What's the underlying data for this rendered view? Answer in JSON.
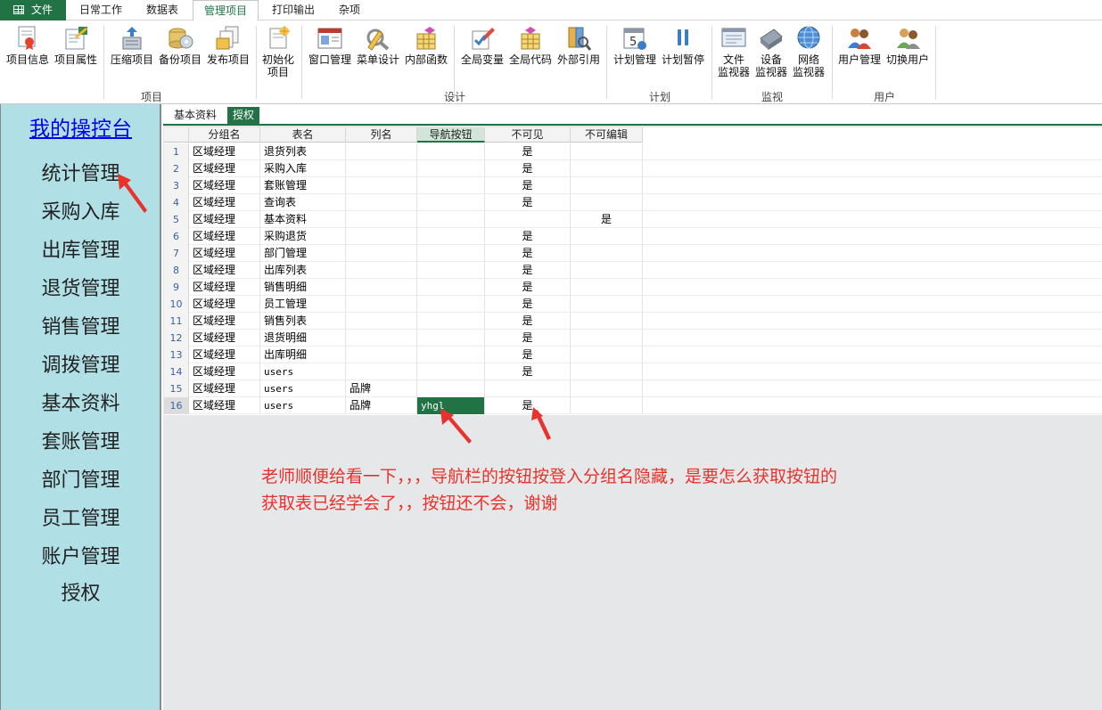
{
  "ribbon_tabs": [
    "文件",
    "日常工作",
    "数据表",
    "管理项目",
    "打印输出",
    "杂项"
  ],
  "ribbon_groups": [
    "项目",
    "设计",
    "计划",
    "监视",
    "用户"
  ],
  "ribbon_buttons": [
    {
      "label": "项目信息",
      "icon": "certificate-icon"
    },
    {
      "label": "项目属性",
      "icon": "document-pencil-icon"
    },
    {
      "label": "压缩项目",
      "icon": "compress-icon"
    },
    {
      "label": "备份项目",
      "icon": "backup-disc-icon"
    },
    {
      "label": "发布项目",
      "icon": "publish-icon"
    },
    {
      "label": "初始化\n项目",
      "icon": "init-project-icon"
    },
    {
      "label": "窗口管理",
      "icon": "window-icon"
    },
    {
      "label": "菜单设计",
      "icon": "menu-design-icon"
    },
    {
      "label": "内部函数",
      "icon": "function-icon"
    },
    {
      "label": "全局变量",
      "icon": "variable-icon"
    },
    {
      "label": "全局代码",
      "icon": "code-icon"
    },
    {
      "label": "外部引用",
      "icon": "reference-icon"
    },
    {
      "label": "计划管理",
      "icon": "calendar-icon"
    },
    {
      "label": "计划暂停",
      "icon": "pause-icon"
    },
    {
      "label": "文件\n监视器",
      "icon": "file-monitor-icon"
    },
    {
      "label": "设备\n监视器",
      "icon": "device-monitor-icon"
    },
    {
      "label": "网络\n监视器",
      "icon": "globe-icon"
    },
    {
      "label": "用户管理",
      "icon": "users-icon"
    },
    {
      "label": "切换用户",
      "icon": "switch-user-icon"
    }
  ],
  "sidebar": {
    "title": "我的操控台",
    "items": [
      "统计管理",
      "采购入库",
      "出库管理",
      "退货管理",
      "销售管理",
      "调拨管理",
      "基本资料",
      "套账管理",
      "部门管理",
      "员工管理",
      "账户管理",
      "授权"
    ]
  },
  "subtabs": [
    "基本资料",
    "授权"
  ],
  "grid": {
    "columns": [
      "分组名",
      "表名",
      "列名",
      "导航按钮",
      "不可见",
      "不可编辑"
    ],
    "rows": [
      {
        "n": "1",
        "group": "区域经理",
        "table": "退货列表",
        "col": "",
        "nav": "",
        "hidden": "是",
        "noedit": ""
      },
      {
        "n": "2",
        "group": "区域经理",
        "table": "采购入库",
        "col": "",
        "nav": "",
        "hidden": "是",
        "noedit": ""
      },
      {
        "n": "3",
        "group": "区域经理",
        "table": "套账管理",
        "col": "",
        "nav": "",
        "hidden": "是",
        "noedit": ""
      },
      {
        "n": "4",
        "group": "区域经理",
        "table": "查询表",
        "col": "",
        "nav": "",
        "hidden": "是",
        "noedit": ""
      },
      {
        "n": "5",
        "group": "区域经理",
        "table": "基本资料",
        "col": "",
        "nav": "",
        "hidden": "",
        "noedit": "是"
      },
      {
        "n": "6",
        "group": "区域经理",
        "table": "采购退货",
        "col": "",
        "nav": "",
        "hidden": "是",
        "noedit": ""
      },
      {
        "n": "7",
        "group": "区域经理",
        "table": "部门管理",
        "col": "",
        "nav": "",
        "hidden": "是",
        "noedit": ""
      },
      {
        "n": "8",
        "group": "区域经理",
        "table": "出库列表",
        "col": "",
        "nav": "",
        "hidden": "是",
        "noedit": ""
      },
      {
        "n": "9",
        "group": "区域经理",
        "table": "销售明细",
        "col": "",
        "nav": "",
        "hidden": "是",
        "noedit": ""
      },
      {
        "n": "10",
        "group": "区域经理",
        "table": "员工管理",
        "col": "",
        "nav": "",
        "hidden": "是",
        "noedit": ""
      },
      {
        "n": "11",
        "group": "区域经理",
        "table": "销售列表",
        "col": "",
        "nav": "",
        "hidden": "是",
        "noedit": ""
      },
      {
        "n": "12",
        "group": "区域经理",
        "table": "退货明细",
        "col": "",
        "nav": "",
        "hidden": "是",
        "noedit": ""
      },
      {
        "n": "13",
        "group": "区域经理",
        "table": "出库明细",
        "col": "",
        "nav": "",
        "hidden": "是",
        "noedit": ""
      },
      {
        "n": "14",
        "group": "区域经理",
        "table": "users",
        "col": "",
        "nav": "",
        "hidden": "是",
        "noedit": ""
      },
      {
        "n": "15",
        "group": "区域经理",
        "table": "users",
        "col": "品牌",
        "nav": "",
        "hidden": "",
        "noedit": ""
      },
      {
        "n": "16",
        "group": "区域经理",
        "table": "users",
        "col": "品牌",
        "nav": "yhgl",
        "hidden": "是",
        "noedit": ""
      }
    ]
  },
  "annotation": {
    "line1": "老师顺便给看一下，，，导航栏的按钮按登入分组名隐藏，是要怎么获取按钮的",
    "line2": "获取表已经学会了，，按钮还不会，谢谢",
    "color": "#e8322b"
  },
  "colors": {
    "accent": "#217346",
    "sidebar_bg": "#b0dfe6",
    "link": "#0000ee"
  }
}
